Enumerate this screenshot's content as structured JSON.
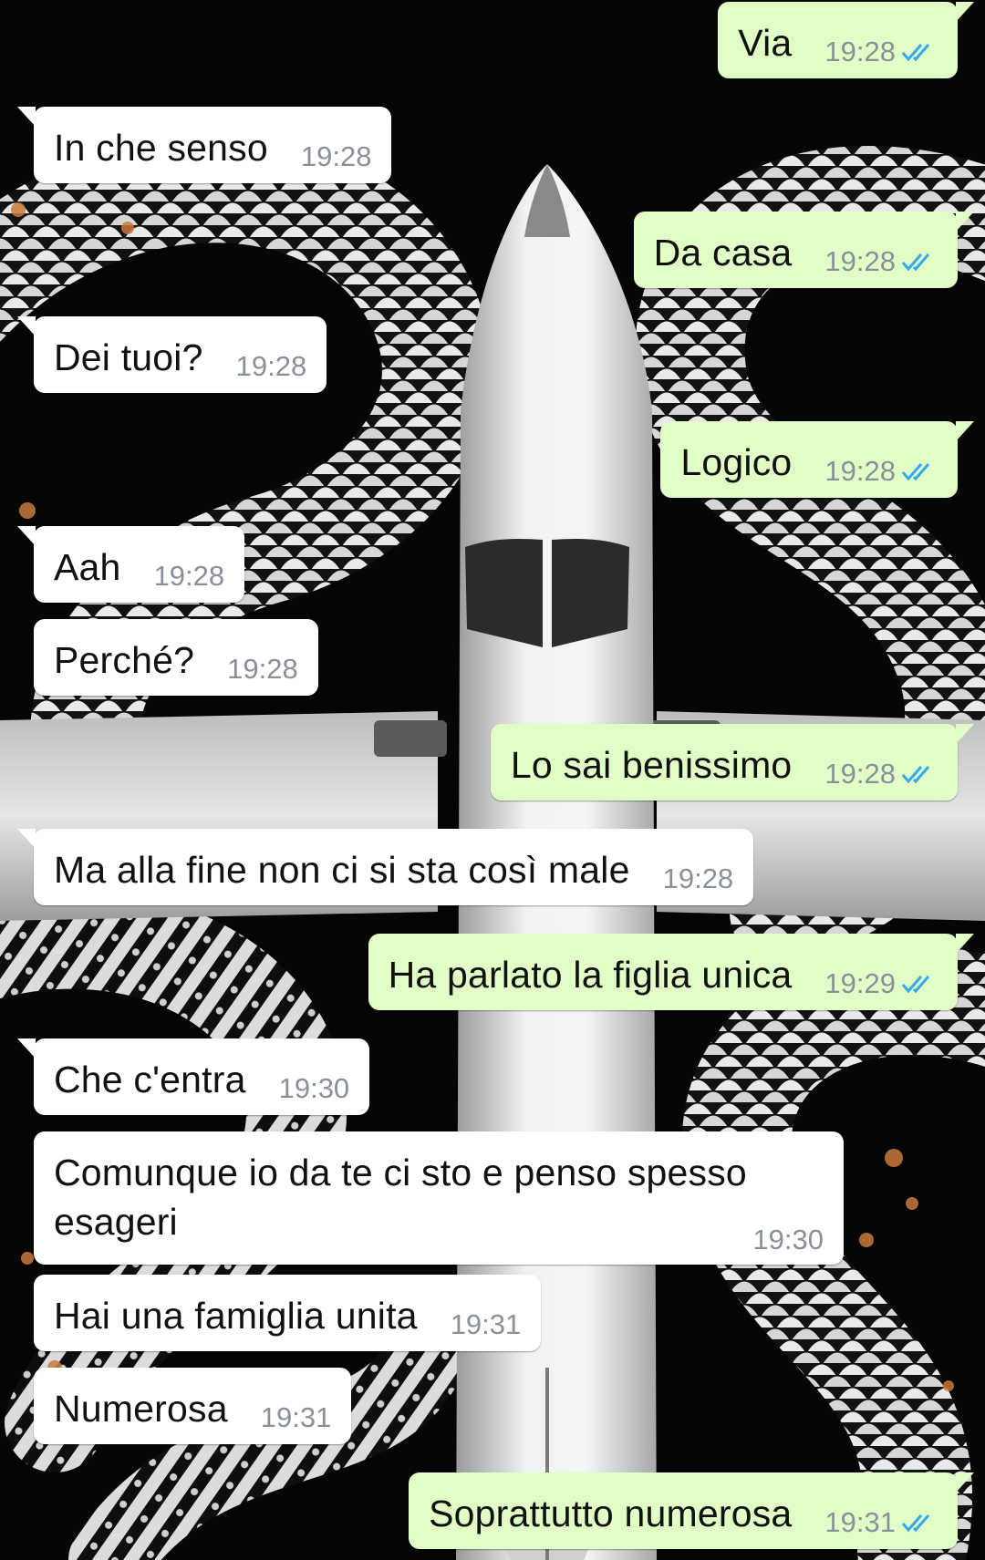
{
  "colors": {
    "incoming_bubble": "#ffffff",
    "outgoing_bubble": "#e1fec6",
    "timestamp": "#8a9099",
    "read_ticks": "#34a9f0"
  },
  "icons": {
    "read_receipt": "double-check-icon"
  },
  "messages": [
    {
      "dir": "out",
      "text": "Via",
      "time": "19:28",
      "read": true
    },
    {
      "dir": "in",
      "text": "In che senso",
      "time": "19:28"
    },
    {
      "dir": "out",
      "text": "Da casa",
      "time": "19:28",
      "read": true
    },
    {
      "dir": "in",
      "text": "Dei tuoi?",
      "time": "19:28"
    },
    {
      "dir": "out",
      "text": "Logico",
      "time": "19:28",
      "read": true
    },
    {
      "dir": "in",
      "text": "Aah",
      "time": "19:28"
    },
    {
      "dir": "in",
      "text": "Perché?",
      "time": "19:28"
    },
    {
      "dir": "out",
      "text": "Lo sai benissimo",
      "time": "19:28",
      "read": true
    },
    {
      "dir": "in",
      "text": "Ma alla fine non ci si sta così male",
      "time": "19:28"
    },
    {
      "dir": "out",
      "text": "Ha parlato la figlia unica",
      "time": "19:29",
      "read": true
    },
    {
      "dir": "in",
      "text": "Che c'entra",
      "time": "19:30"
    },
    {
      "dir": "in",
      "text": "Comunque io da te ci sto e penso spesso esageri",
      "time": "19:30"
    },
    {
      "dir": "in",
      "text": "Hai una famiglia unita",
      "time": "19:31"
    },
    {
      "dir": "in",
      "text": "Numerosa",
      "time": "19:31"
    },
    {
      "dir": "out",
      "text": "Soprattutto numerosa",
      "time": "19:31",
      "read": true
    }
  ]
}
